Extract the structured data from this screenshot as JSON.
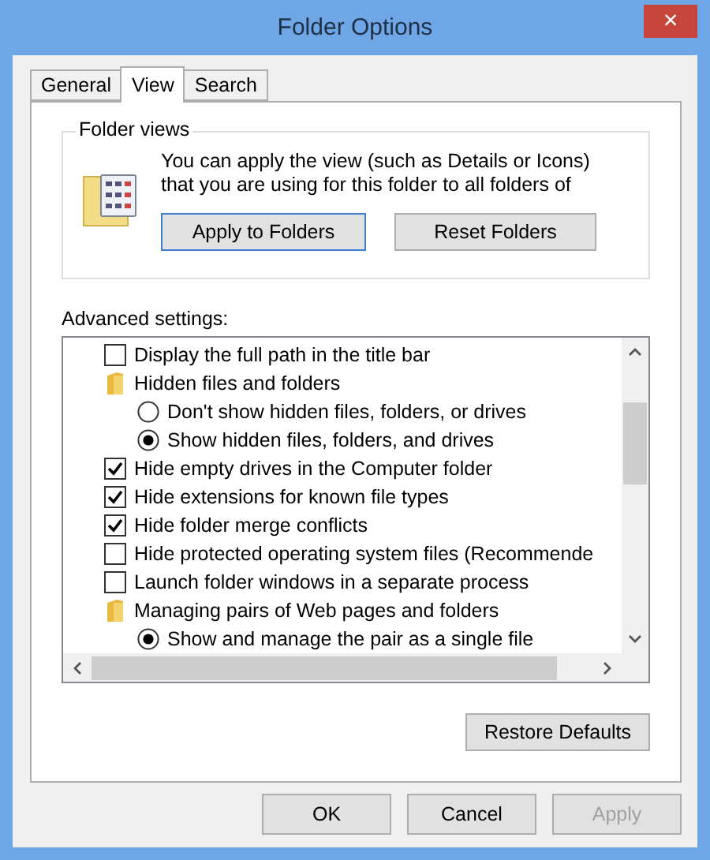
{
  "window": {
    "title": "Folder Options",
    "close": "×"
  },
  "tabs": [
    {
      "label": "General",
      "selected": false
    },
    {
      "label": "View",
      "selected": true
    },
    {
      "label": "Search",
      "selected": false
    }
  ],
  "folder_views": {
    "legend": "Folder views",
    "description": "You can apply the view (such as Details or Icons) that you are using for this folder to all folders of",
    "buttons": [
      {
        "label": "Apply to Folders",
        "focused": true
      },
      {
        "label": "Reset Folders",
        "focused": false
      }
    ]
  },
  "advanced": {
    "label": "Advanced settings:",
    "items": [
      {
        "kind": "checkbox",
        "label": "Display the full path in the title bar",
        "checked": false
      },
      {
        "kind": "folder",
        "label": "Hidden files and folders",
        "children": [
          {
            "label": "Don't show hidden files, folders, or drives",
            "selected": false
          },
          {
            "label": "Show hidden files, folders, and drives",
            "selected": true
          }
        ]
      },
      {
        "kind": "checkbox",
        "label": "Hide empty drives in the Computer folder",
        "checked": true
      },
      {
        "kind": "checkbox",
        "label": "Hide extensions for known file types",
        "checked": true
      },
      {
        "kind": "checkbox",
        "label": "Hide folder merge conflicts",
        "checked": true
      },
      {
        "kind": "checkbox",
        "label": "Hide protected operating system files (Recommende",
        "checked": false
      },
      {
        "kind": "checkbox",
        "label": "Launch folder windows in a separate process",
        "checked": false
      },
      {
        "kind": "folder",
        "label": "Managing pairs of Web pages and folders",
        "children": [
          {
            "label": "Show and manage the pair as a single file",
            "selected": true
          }
        ]
      }
    ],
    "restore": "Restore Defaults"
  },
  "buttons": [
    {
      "label": "OK",
      "disabled": false
    },
    {
      "label": "Cancel",
      "disabled": false
    },
    {
      "label": "Apply",
      "disabled": true
    }
  ]
}
